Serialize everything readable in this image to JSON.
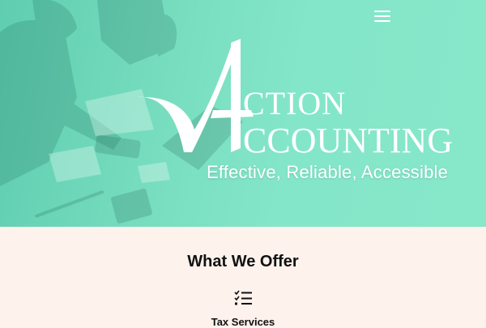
{
  "hero": {
    "logo": {
      "line1": "CTION",
      "line2": "CCOUNTING"
    },
    "tagline": "Effective, Reliable, Accessible"
  },
  "menu": {
    "icon": "hamburger-menu-icon"
  },
  "offer": {
    "title": "What We Offer",
    "services": [
      {
        "label": "Tax Services",
        "icon": "checklist-icon"
      }
    ]
  },
  "colors": {
    "hero_teal": "#84e6c8",
    "section_bg": "#fdf2ec",
    "heading": "#111111",
    "logo_white": "#ffffff"
  }
}
